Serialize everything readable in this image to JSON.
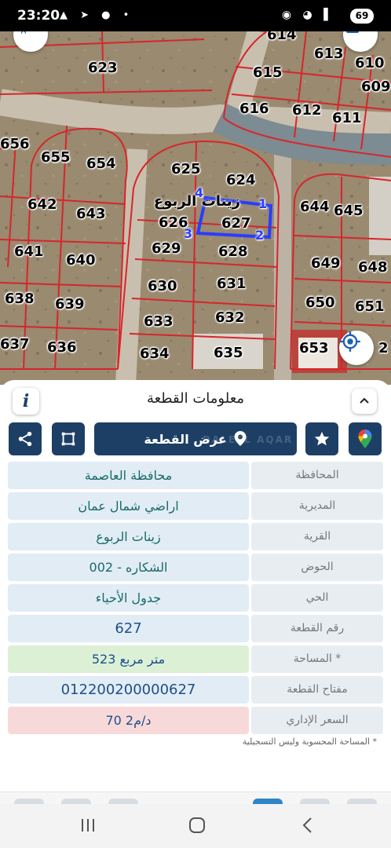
{
  "status_bar": {
    "time": "23:20",
    "battery": "69",
    "left_icons": "▲ ➤ ● •",
    "right_icons": "◉ ◕ ▌"
  },
  "map": {
    "plots": [
      {
        "id": "614",
        "label": "614"
      },
      {
        "id": "613",
        "label": "613"
      },
      {
        "id": "610",
        "label": "610"
      },
      {
        "id": "609",
        "label": "609"
      },
      {
        "id": "623",
        "label": "623"
      },
      {
        "id": "615",
        "label": "615"
      },
      {
        "id": "616",
        "label": "616"
      },
      {
        "id": "612",
        "label": "612"
      },
      {
        "id": "611",
        "label": "611"
      },
      {
        "id": "656",
        "label": "656"
      },
      {
        "id": "655",
        "label": "655"
      },
      {
        "id": "654",
        "label": "654"
      },
      {
        "id": "625",
        "label": "625"
      },
      {
        "id": "624",
        "label": "624"
      },
      {
        "id": "642",
        "label": "642"
      },
      {
        "id": "643",
        "label": "643"
      },
      {
        "id": "626",
        "label": "626"
      },
      {
        "id": "627",
        "label": "627"
      },
      {
        "id": "644",
        "label": "644"
      },
      {
        "id": "645",
        "label": "645"
      },
      {
        "id": "641",
        "label": "641"
      },
      {
        "id": "640",
        "label": "640"
      },
      {
        "id": "629",
        "label": "629"
      },
      {
        "id": "628",
        "label": "628"
      },
      {
        "id": "649",
        "label": "649"
      },
      {
        "id": "648",
        "label": "648"
      },
      {
        "id": "630",
        "label": "630"
      },
      {
        "id": "631",
        "label": "631"
      },
      {
        "id": "638",
        "label": "638"
      },
      {
        "id": "639",
        "label": "639"
      },
      {
        "id": "650",
        "label": "650"
      },
      {
        "id": "651",
        "label": "651"
      },
      {
        "id": "633",
        "label": "633"
      },
      {
        "id": "632",
        "label": "632"
      },
      {
        "id": "637",
        "label": "637"
      },
      {
        "id": "636",
        "label": "636"
      },
      {
        "id": "634",
        "label": "634"
      },
      {
        "id": "635",
        "label": "635"
      },
      {
        "id": "653",
        "label": "653"
      },
      {
        "id": "652",
        "label": "2"
      }
    ],
    "village_label": "زينات الربوع",
    "vertices": [
      "1",
      "2",
      "3",
      "4"
    ],
    "colors": {
      "parcel_lines": "#d8252b",
      "selection": "#2a3cff",
      "accent": "#1d3f66"
    }
  },
  "sheet": {
    "title": "معلومات القطعة",
    "info_icon": "i",
    "show_plot_label": "عرض القطعة",
    "watermark": "DALEEL AQAR",
    "rows": [
      {
        "label": "المحافظة",
        "value": "محافظة العاصمة"
      },
      {
        "label": "المديرية",
        "value": "اراضي شمال عمان"
      },
      {
        "label": "القرية",
        "value": "زينات الربوع"
      },
      {
        "label": "الحوض",
        "value": "الشكاره - 002"
      },
      {
        "label": "الحي",
        "value": "جدول الأحياء"
      },
      {
        "label": "رقم القطعة",
        "value": "627"
      },
      {
        "label": "المساحة *",
        "value": "523   متر مربع"
      },
      {
        "label": "مفتاح القطعة",
        "value": "012200200000627"
      },
      {
        "label": "السعر الإداري",
        "value": "70 د/م2"
      }
    ],
    "footnote": "* المساحة المحسوبة وليس التسجيلية"
  }
}
